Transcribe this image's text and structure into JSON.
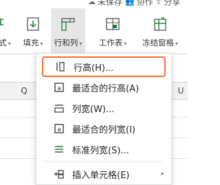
{
  "top_actions": [
    {
      "label": "未保存",
      "icon": "cloud-sync-icon"
    },
    {
      "label": "协作",
      "icon": "collaborate-icon"
    },
    {
      "label": "分享",
      "icon": "share-icon"
    }
  ],
  "ribbon": {
    "items": [
      {
        "label": "式",
        "has_caret": true
      },
      {
        "label": "填充",
        "has_caret": true
      },
      {
        "label": "行和列",
        "has_caret": true
      },
      {
        "label": "工作表",
        "has_caret": true
      },
      {
        "label": "冻结窗格",
        "has_caret": true
      }
    ]
  },
  "columns": [
    "Q",
    "U"
  ],
  "menu": {
    "items": [
      {
        "label": "行高(H)...",
        "icon": "row-height-icon"
      },
      {
        "label": "最适合的行高(A)",
        "icon": "autofit-row-height-icon"
      },
      {
        "label": "列宽(W)...",
        "icon": "column-width-icon"
      },
      {
        "label": "最适合的列宽(I)",
        "icon": "autofit-column-width-icon"
      },
      {
        "label": "标准列宽(S)...",
        "icon": "standard-width-icon"
      },
      {
        "label": "插入单元格(E)",
        "icon": "insert-cells-icon"
      }
    ]
  },
  "colors": {
    "highlight": "#ff6a2b",
    "accent": "#1a7f37"
  }
}
